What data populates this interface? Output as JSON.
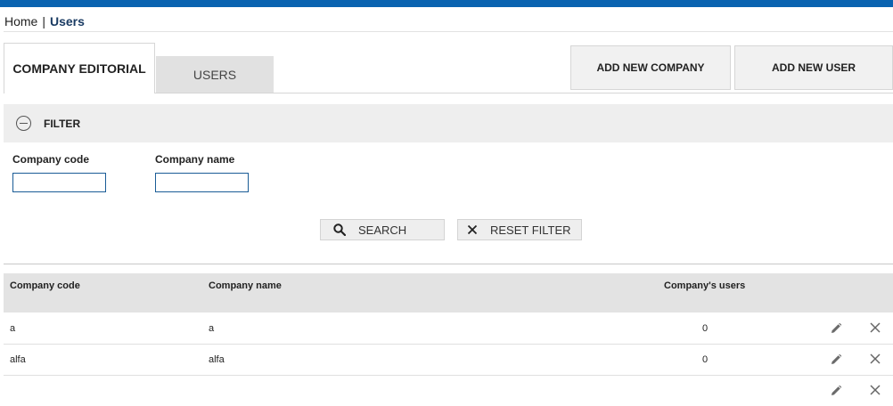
{
  "breadcrumb": {
    "home": "Home",
    "separator": "|",
    "current": "Users"
  },
  "tabs": [
    {
      "label": "COMPANY EDITORIAL",
      "active": true
    },
    {
      "label": "USERS",
      "active": false
    }
  ],
  "actions": {
    "add_company": "ADD NEW COMPANY",
    "add_user": "ADD NEW USER"
  },
  "filter": {
    "title": "FILTER",
    "fields": {
      "company_code": {
        "label": "Company code",
        "value": ""
      },
      "company_name": {
        "label": "Company name",
        "value": ""
      }
    },
    "search_label": "SEARCH",
    "reset_label": "RESET FILTER"
  },
  "table": {
    "headers": {
      "code": "Company code",
      "name": "Company name",
      "users": "Company's users"
    },
    "rows": [
      {
        "code": "a",
        "name": "a",
        "users": "0"
      },
      {
        "code": "alfa",
        "name": "alfa",
        "users": "0"
      }
    ]
  },
  "colors": {
    "topbar": "#0a63b0",
    "breadcrumb_current": "#1a3b63",
    "input_border": "#1a5c96"
  },
  "icons": {
    "filter": "minus-circle-icon",
    "search": "search-icon",
    "reset": "close-icon",
    "edit": "pencil-icon",
    "delete": "close-icon"
  }
}
